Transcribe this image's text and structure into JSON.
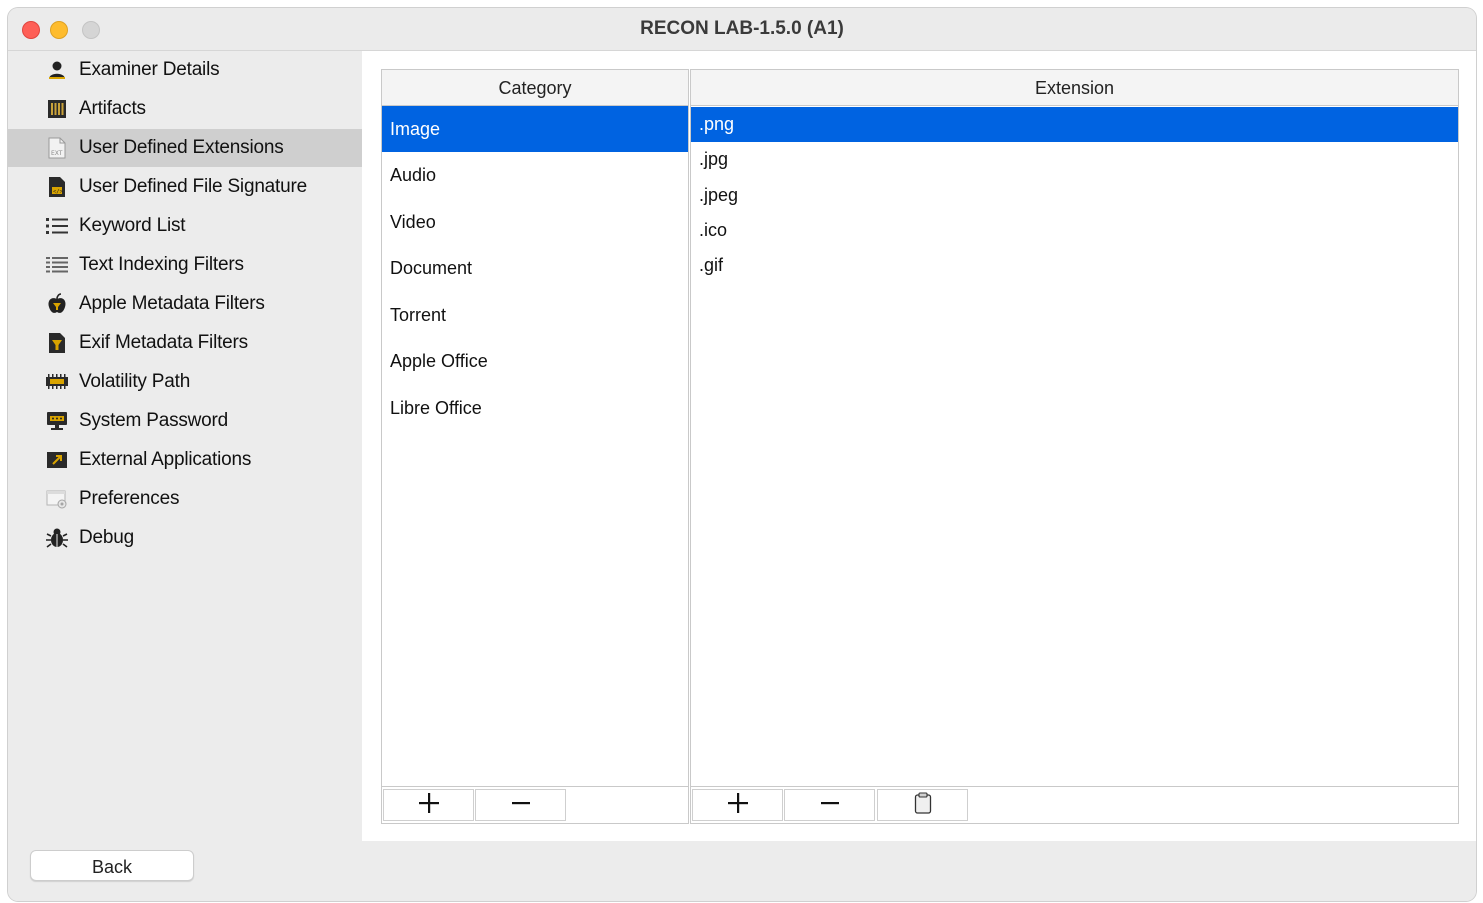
{
  "window": {
    "title": "RECON LAB-1.5.0 (A1)"
  },
  "sidebar": {
    "items": [
      {
        "label": "Examiner Details",
        "icon": "user-icon"
      },
      {
        "label": "Artifacts",
        "icon": "artifacts-icon"
      },
      {
        "label": "User Defined Extensions",
        "icon": "extension-file-icon"
      },
      {
        "label": "User Defined File Signature",
        "icon": "file-signature-icon"
      },
      {
        "label": "Keyword List",
        "icon": "list-icon"
      },
      {
        "label": "Text Indexing Filters",
        "icon": "text-index-icon"
      },
      {
        "label": "Apple Metadata Filters",
        "icon": "apple-icon"
      },
      {
        "label": "Exif Metadata Filters",
        "icon": "exif-filter-icon"
      },
      {
        "label": "Volatility Path",
        "icon": "ram-icon"
      },
      {
        "label": "System Password",
        "icon": "monitor-password-icon"
      },
      {
        "label": "External Applications",
        "icon": "external-link-icon"
      },
      {
        "label": "Preferences",
        "icon": "preferences-icon"
      },
      {
        "label": "Debug",
        "icon": "bug-icon"
      }
    ],
    "selected_index": 2
  },
  "category_panel": {
    "header": "Category",
    "items": [
      "Image",
      "Audio",
      "Video",
      "Document",
      "Torrent",
      "Apple Office",
      "Libre Office"
    ],
    "selected_index": 0,
    "toolbar": {
      "add": "+",
      "remove": "−"
    }
  },
  "extension_panel": {
    "header": "Extension",
    "items": [
      ".png",
      ".jpg",
      ".jpeg",
      ".ico",
      ".gif"
    ],
    "selected_index": 0,
    "toolbar": {
      "add": "+",
      "remove": "−",
      "paste": "clipboard-icon"
    }
  },
  "footer": {
    "back_label": "Back"
  },
  "colors": {
    "selection": "#0063e1",
    "sidebar_selected": "#cfcfcf",
    "window_bg": "#ececec"
  }
}
